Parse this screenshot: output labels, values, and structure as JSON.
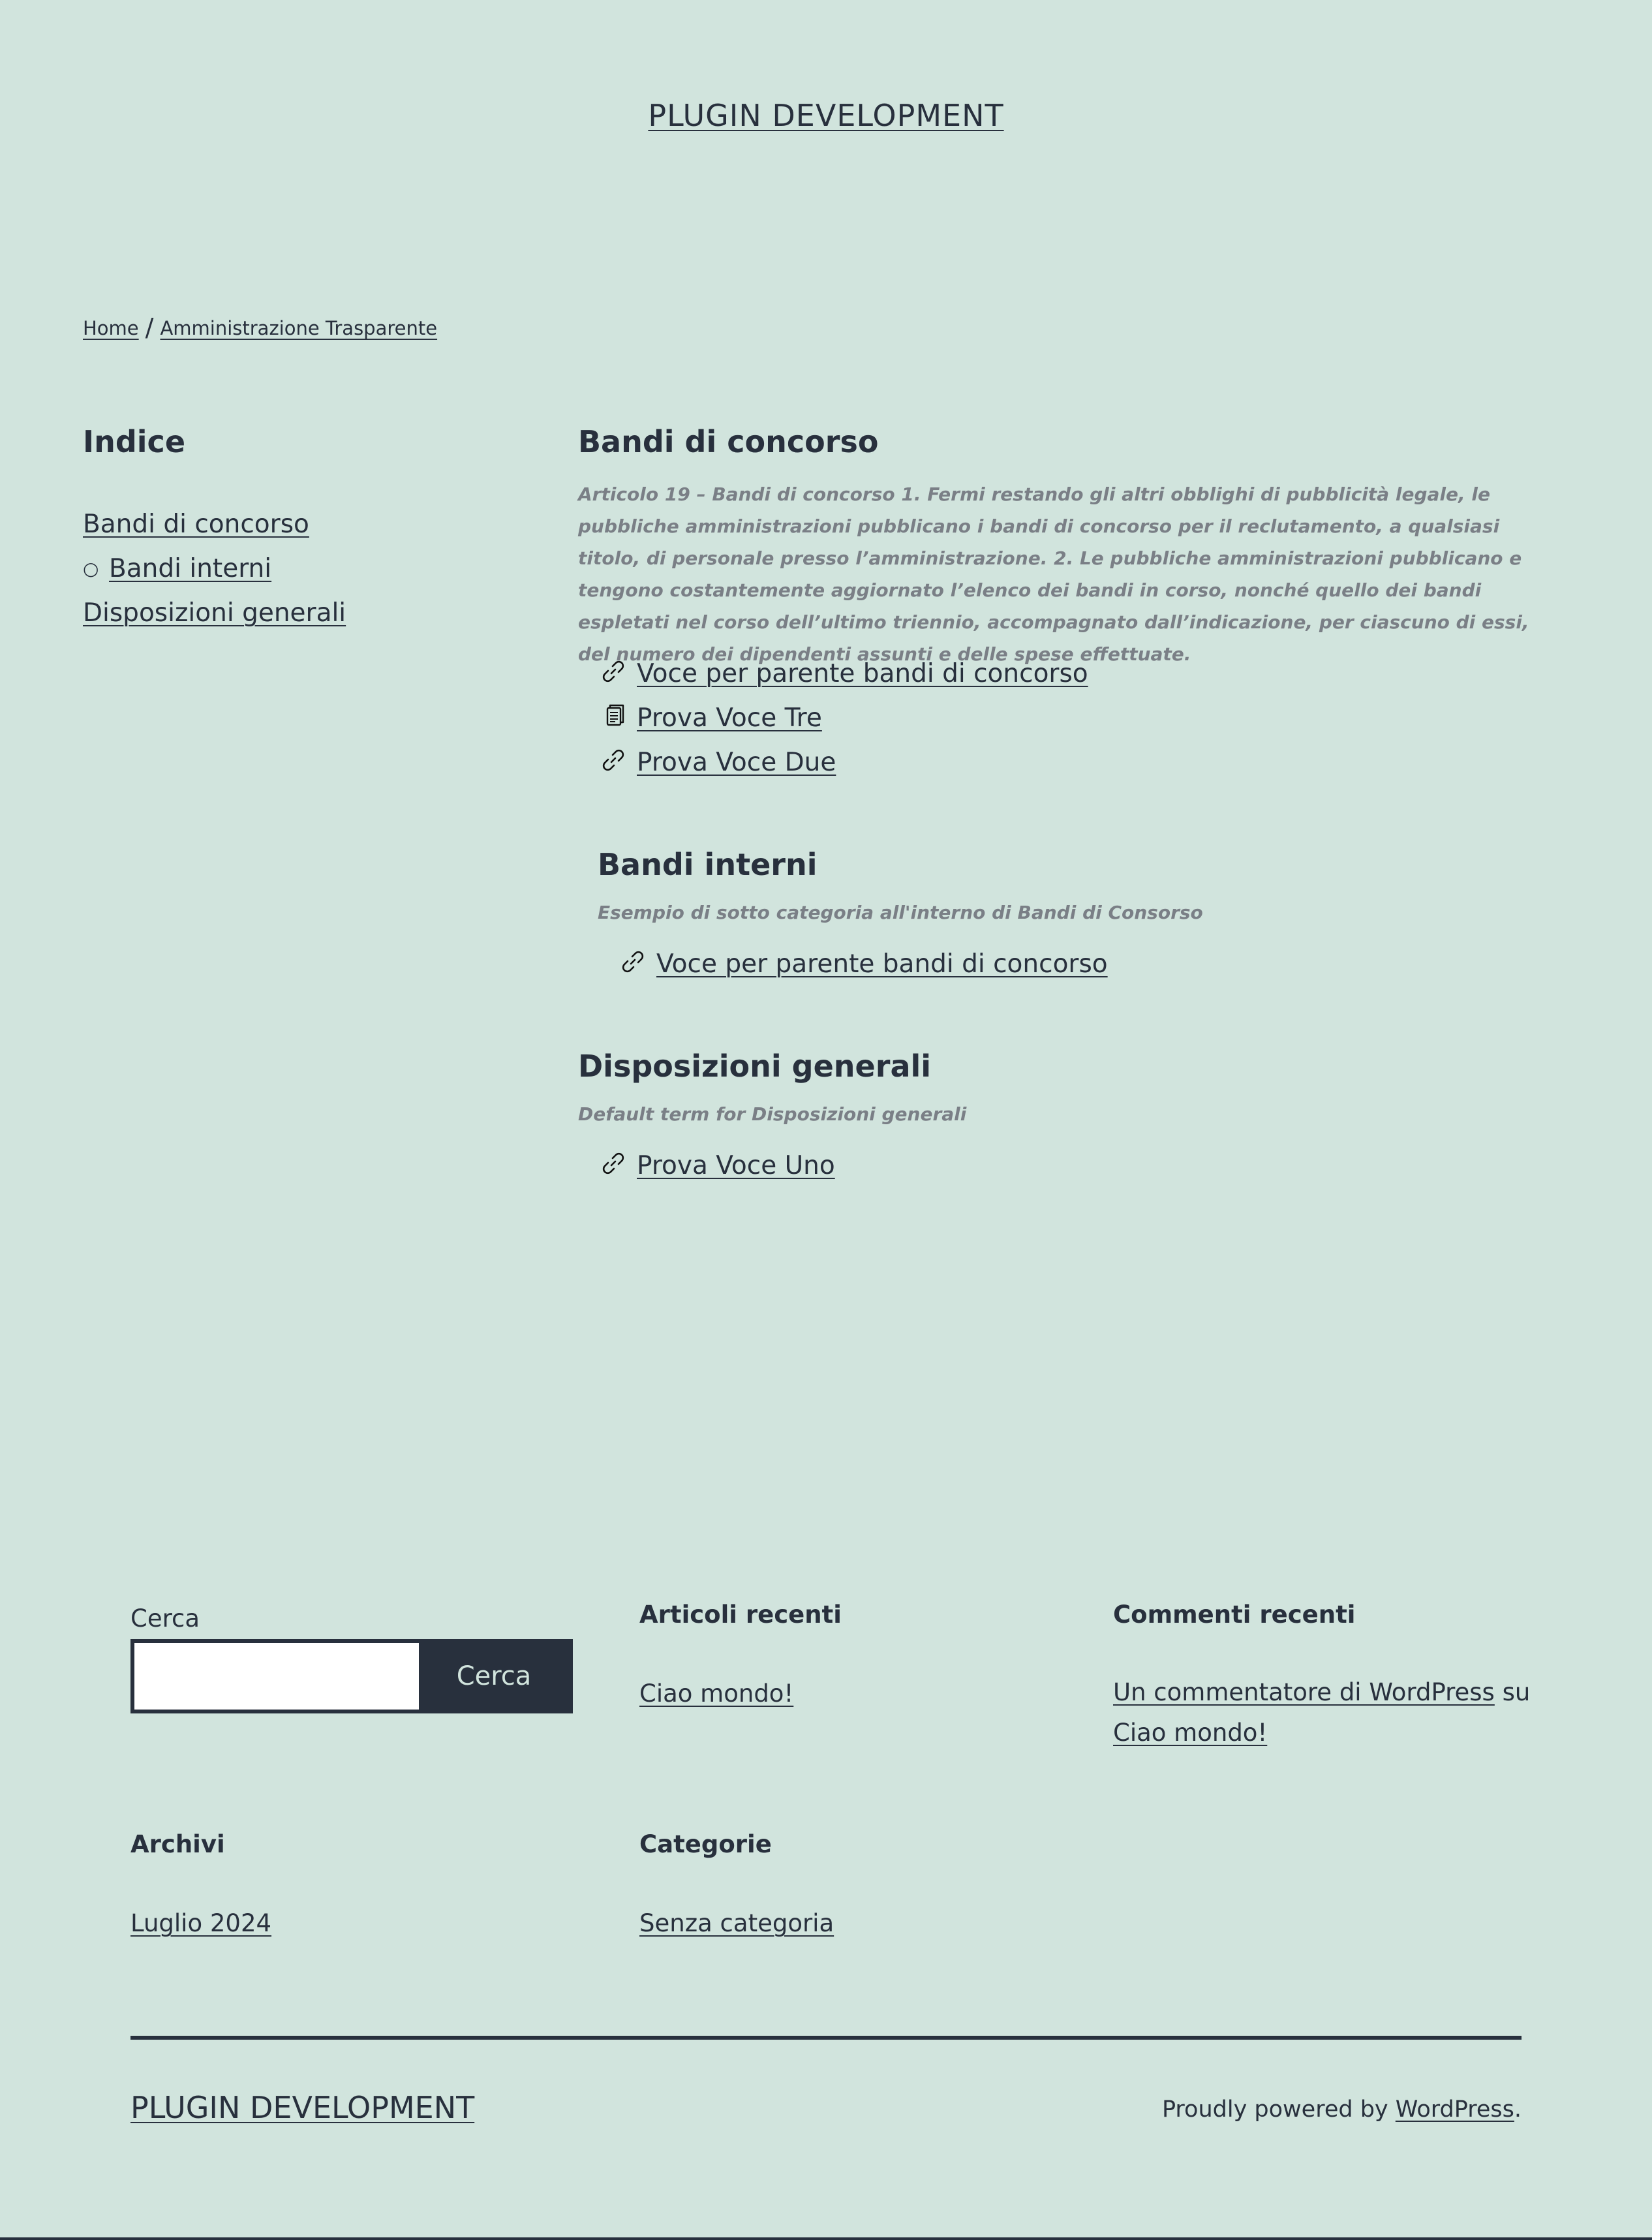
{
  "header": {
    "site_title": "PLUGIN DEVELOPMENT"
  },
  "breadcrumb": {
    "home": "Home",
    "separator": "/",
    "current": "Amministrazione Trasparente"
  },
  "sidebar": {
    "title": "Indice",
    "items": [
      {
        "label": "Bandi di concorso"
      },
      {
        "label": "Bandi interni",
        "bullet": "○"
      },
      {
        "label": "Disposizioni generali"
      }
    ]
  },
  "sections": [
    {
      "title": "Bandi di concorso",
      "description": "Articolo 19 – Bandi di concorso 1. Fermi restando gli altri obblighi di pubblicità legale, le pubbliche amministrazioni pubblicano i bandi di concorso per il reclutamento, a qualsiasi titolo, di personale presso l’amministrazione. 2. Le pubbliche amministrazioni pubblicano e tengono costantemente aggiornato l’elenco dei bandi in corso, nonché quello dei bandi espletati nel corso dell’ultimo triennio, accompagnato dall’indicazione, per ciascuno di essi, del numero dei dipendenti assunti e delle spese effettuate.",
      "items": [
        {
          "label": "Voce per parente bandi di concorso",
          "icon": "link-icon"
        },
        {
          "label": "Prova Voce Tre",
          "icon": "document-icon"
        },
        {
          "label": "Prova Voce Due",
          "icon": "link-icon"
        }
      ]
    },
    {
      "title": "Bandi interni",
      "description": "Esempio di sotto categoria all'interno di Bandi di Consorso",
      "items": [
        {
          "label": "Voce per parente bandi di concorso",
          "icon": "link-icon"
        }
      ]
    },
    {
      "title": "Disposizioni generali",
      "description": "Default term for Disposizioni generali",
      "items": [
        {
          "label": "Prova Voce Uno",
          "icon": "link-icon"
        }
      ]
    }
  ],
  "footer": {
    "search": {
      "label": "Cerca",
      "button": "Cerca",
      "value": ""
    },
    "recent_posts": {
      "title": "Articoli recenti",
      "items": [
        "Ciao mondo!"
      ]
    },
    "recent_comments": {
      "title": "Commenti recenti",
      "author": "Un commentatore di WordPress",
      "connector": "su",
      "post": "Ciao mondo!"
    },
    "archives": {
      "title": "Archivi",
      "items": [
        "Luglio 2024"
      ]
    },
    "categories": {
      "title": "Categorie",
      "items": [
        "Senza categoria"
      ]
    },
    "site_title": "PLUGIN DEVELOPMENT",
    "powered_prefix": "Proudly powered by",
    "powered_link": "WordPress",
    "powered_suffix": "."
  }
}
